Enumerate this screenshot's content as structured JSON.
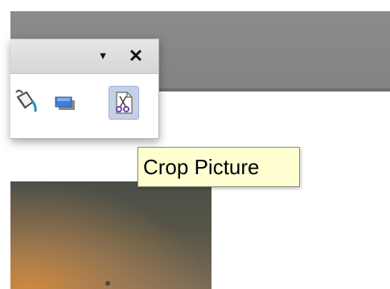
{
  "toolbar": {
    "menu_glyph": "▾",
    "close_glyph": "✕",
    "tools": [
      {
        "icon": "fill-bucket-icon",
        "active": false
      },
      {
        "icon": "shadow-icon",
        "active": false
      },
      {
        "icon": "crop-icon",
        "active": true
      }
    ]
  },
  "tooltip": {
    "text": "Crop Picture"
  },
  "colors": {
    "workspace": "#898989",
    "tooltip_bg": "#ffffd2",
    "active_tool_bg": "#c5d1e6",
    "shadow_blue": "#3f7fd9"
  }
}
